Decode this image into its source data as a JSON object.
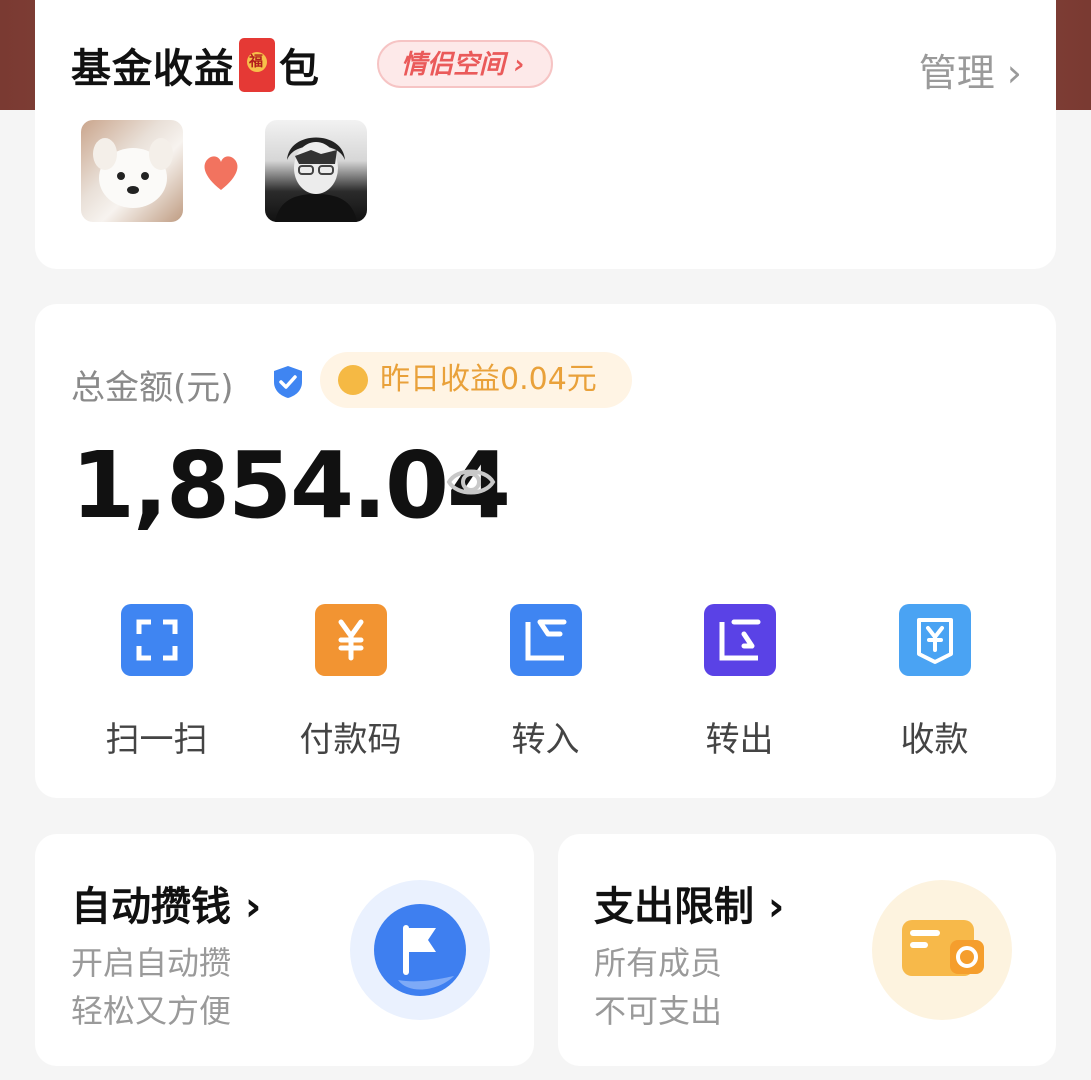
{
  "space": {
    "title_part1": "基金收益",
    "title_part2": "包",
    "redpacket_glyph": "福",
    "couple_tag": "情侣空间 ›",
    "manage": "管理 ›",
    "avatars": [
      "dog-avatar",
      "man-avatar"
    ]
  },
  "balance": {
    "total_label": "总金额(元)",
    "yesterday_yield": "昨日收益0.04元",
    "amount": "1,854.04",
    "actions": [
      {
        "label": "扫一扫",
        "icon": "scan-icon"
      },
      {
        "label": "付款码",
        "icon": "payment-code-icon"
      },
      {
        "label": "转入",
        "icon": "transfer-in-icon"
      },
      {
        "label": "转出",
        "icon": "transfer-out-icon"
      },
      {
        "label": "收款",
        "icon": "receive-icon"
      }
    ]
  },
  "features": {
    "autosave": {
      "title": "自动攒钱 ›",
      "line1": "开启自动攒",
      "line2": "轻松又方便",
      "icon": "flag-icon"
    },
    "limit": {
      "title": "支出限制 ›",
      "line1": "所有成员",
      "line2": "不可支出",
      "icon": "wallet-icon"
    }
  },
  "colors": {
    "accent_blue": "#3f85f2",
    "orange": "#f29432",
    "purple": "#5a42e6",
    "pink_tag": "#ea5a5a"
  }
}
